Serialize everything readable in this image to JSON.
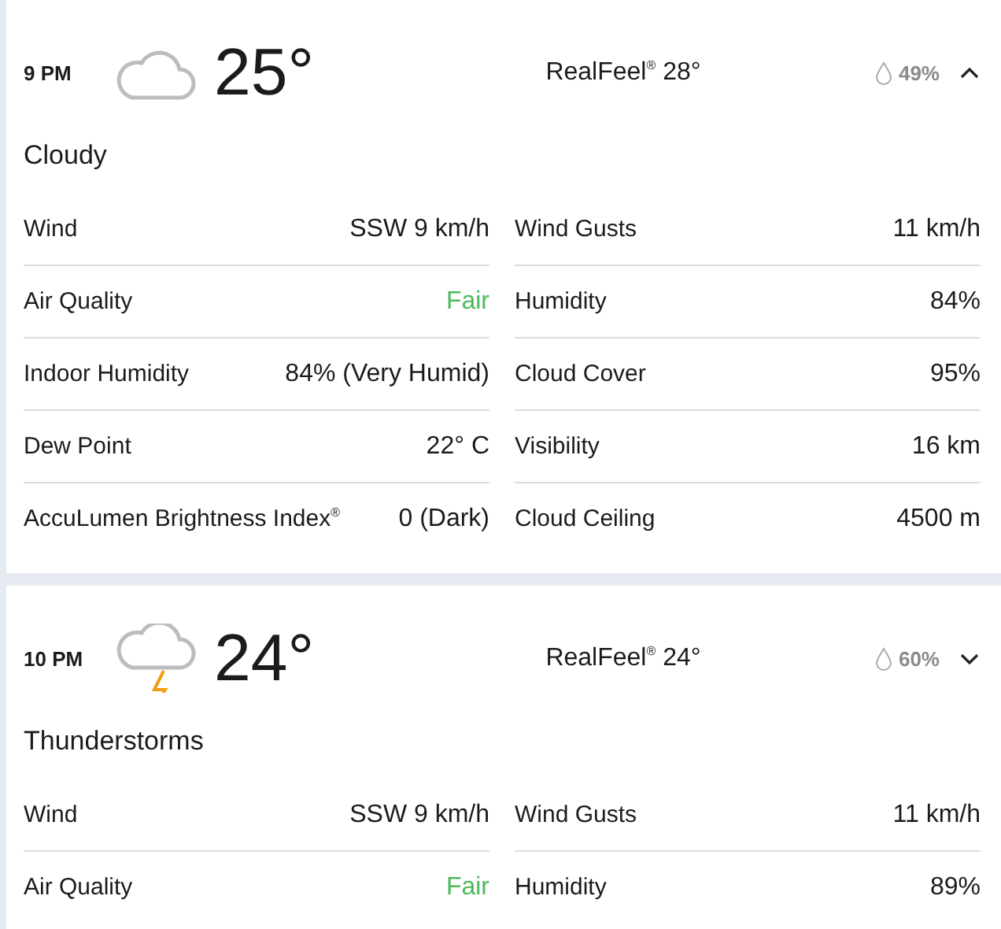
{
  "hours": [
    {
      "time": "9 PM",
      "kind": "cloudy",
      "temperature": "25°",
      "realfeel": "RealFeel$^{®}$ 28°",
      "precipitation": "49%",
      "expanded": true,
      "condition": "Cloudy",
      "details": [
        {
          "label": "Wind",
          "value": "SSW 9 km/h"
        },
        {
          "label": "Wind Gusts",
          "value": "11 km/h"
        },
        {
          "label": "Air Quality",
          "value": "Fair",
          "color": "#4cb85c"
        },
        {
          "label": "Humidity",
          "value": "84%"
        },
        {
          "label": "Indoor Humidity",
          "value": "84% (Very Humid)"
        },
        {
          "label": "Cloud Cover",
          "value": "95%"
        },
        {
          "label": "Dew Point",
          "value": "22° C"
        },
        {
          "label": "Visibility",
          "value": "16 km"
        },
        {
          "label": "AccuLumen Brightness Index$^{®}$",
          "value": "0 (Dark)"
        },
        {
          "label": "Cloud Ceiling",
          "value": "4500 m"
        }
      ]
    },
    {
      "time": "10 PM",
      "kind": "thunderstorm",
      "temperature": "24°",
      "realfeel": "RealFeel$^{®}$ 24°",
      "precipitation": "60%",
      "expanded": false,
      "condition": "Thunderstorms",
      "details": [
        {
          "label": "Wind",
          "value": "SSW 9 km/h"
        },
        {
          "label": "Wind Gusts",
          "value": "11 km/h"
        },
        {
          "label": "Air Quality",
          "value": "Fair",
          "color": "#4cb85c"
        },
        {
          "label": "Humidity",
          "value": "89%"
        }
      ]
    }
  ]
}
